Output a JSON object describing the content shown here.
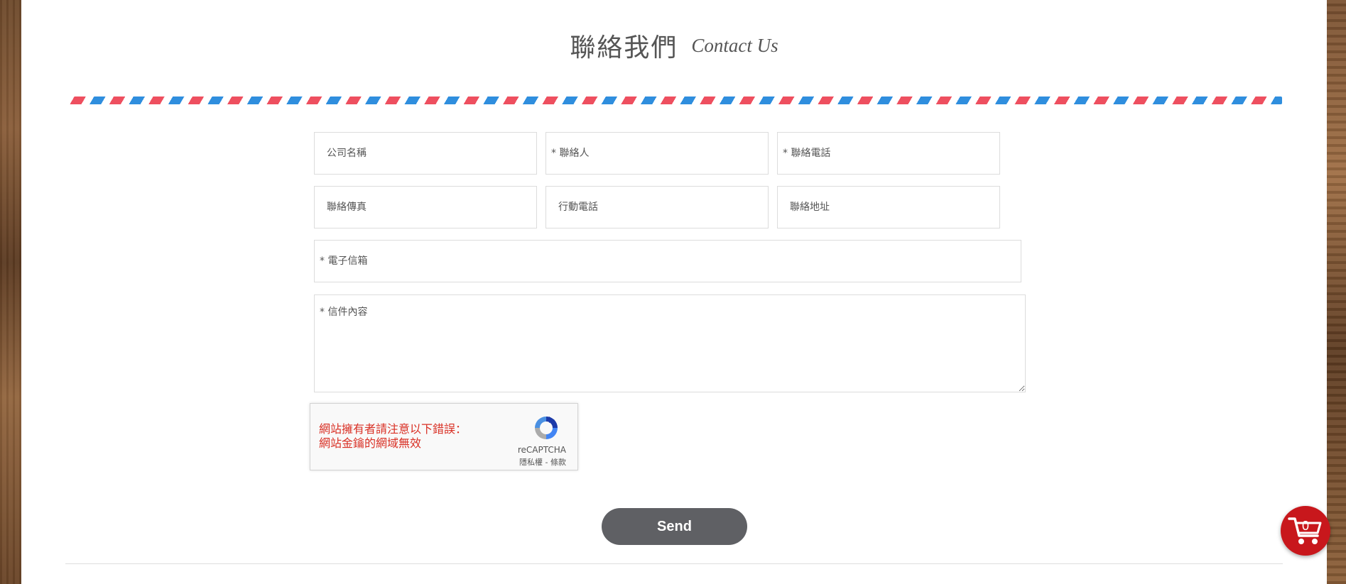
{
  "page": {
    "title_zh": "聯絡我們",
    "title_en": "Contact Us"
  },
  "form": {
    "company_placeholder": "公司名稱",
    "contact_placeholder": "* 聯絡人",
    "phone_placeholder": "* 聯絡電話",
    "fax_placeholder": "聯絡傳真",
    "mobile_placeholder": "行動電話",
    "address_placeholder": "聯絡地址",
    "email_placeholder": "* 電子信箱",
    "message_placeholder": "* 信件內容",
    "send_label": "Send"
  },
  "captcha": {
    "error_line1": "網站擁有者請注意以下錯誤：",
    "error_line2": "網站金鑰的網域無效",
    "brand": "reCAPTCHA",
    "privacy": "隱私權",
    "separator": " - ",
    "terms": "條款"
  },
  "cart": {
    "count": "0"
  },
  "colors": {
    "stripe_blue": "#2f8ede",
    "stripe_red": "#ee4f5f",
    "send_bg": "#5f6064",
    "cart_bg": "#c8171c",
    "error_red": "#d93025"
  },
  "icons": [
    "recaptcha-logo-icon",
    "shopping-cart-icon"
  ]
}
